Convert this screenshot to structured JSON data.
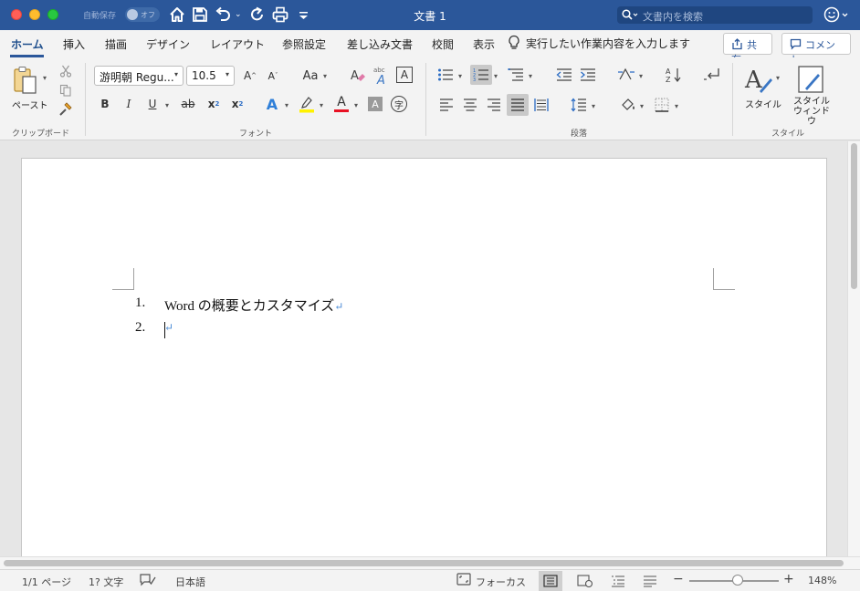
{
  "titlebar": {
    "autosave_label": "自動保存",
    "autosave_state": "オフ",
    "document_title": "文書 1",
    "search_placeholder": "文書内を検索"
  },
  "tabs": [
    "ホーム",
    "挿入",
    "描画",
    "デザイン",
    "レイアウト",
    "参照設定",
    "差し込み文書",
    "校閲",
    "表示"
  ],
  "active_tab": "ホーム",
  "tell_me": "実行したい作業内容を入力します",
  "share_label": "共有",
  "comment_label": "コメント",
  "clipboard": {
    "paste_label": "ペースト",
    "group_label": "クリップボード"
  },
  "font": {
    "font_name": "游明朝 Regu...",
    "font_size": "10.5",
    "change_case": "Aa",
    "group_label": "フォント",
    "bold": "B",
    "italic": "I",
    "underline": "U",
    "strike": "ab",
    "subscript": "x",
    "superscript": "x",
    "grow": "A",
    "shrink": "A",
    "text_effects": "A",
    "font_color": "A",
    "char_shading": "A",
    "char_border": "A",
    "enclose": "字"
  },
  "paragraph": {
    "group_label": "段落"
  },
  "styles": {
    "styles_label": "スタイル",
    "styles_pane_label_1": "スタイル",
    "styles_pane_label_2": "ウィンドウ",
    "group_label": "スタイル"
  },
  "colors": {
    "title_bar": "#2b579a",
    "highlight": "#fff200",
    "font_color": "#e81123"
  },
  "document": {
    "list": [
      {
        "number": "1.",
        "text": "Word の概要とカスタマイズ"
      },
      {
        "number": "2.",
        "text": ""
      }
    ]
  },
  "status": {
    "page": "1/1 ページ",
    "words": "1? 文字",
    "language": "日本語",
    "focus": "フォーカス",
    "zoom": "148%"
  }
}
